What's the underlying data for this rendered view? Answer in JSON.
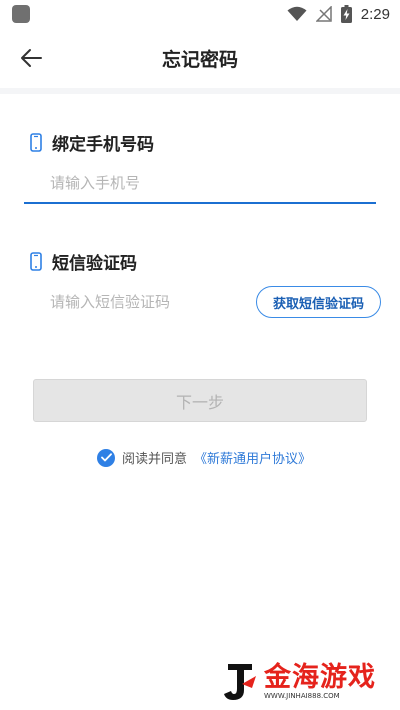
{
  "status_bar": {
    "time": "2:29",
    "icons": [
      "wifi-icon",
      "no-signal-icon",
      "battery-charging-icon"
    ]
  },
  "header": {
    "title": "忘记密码",
    "back_icon": "arrow-left-icon"
  },
  "phone_section": {
    "label": "绑定手机号码",
    "icon": "mobile-phone-icon",
    "placeholder": "请输入手机号",
    "value": ""
  },
  "code_section": {
    "label": "短信验证码",
    "icon": "mobile-phone-icon",
    "placeholder": "请输入短信验证码",
    "value": "",
    "get_code_label": "获取短信验证码"
  },
  "next_button": {
    "label": "下一步",
    "enabled": false
  },
  "agreement": {
    "checked": true,
    "text": "阅读并同意",
    "link_text": "《新薪通用户协议》"
  },
  "watermark": {
    "title": "金海游戏",
    "url": "WWW.JINHAI888.COM"
  },
  "colors": {
    "accent": "#2f80e5",
    "underline": "#1b6fd1",
    "disabled_bg": "#e5e5e5",
    "watermark_red": "#e5231c"
  }
}
